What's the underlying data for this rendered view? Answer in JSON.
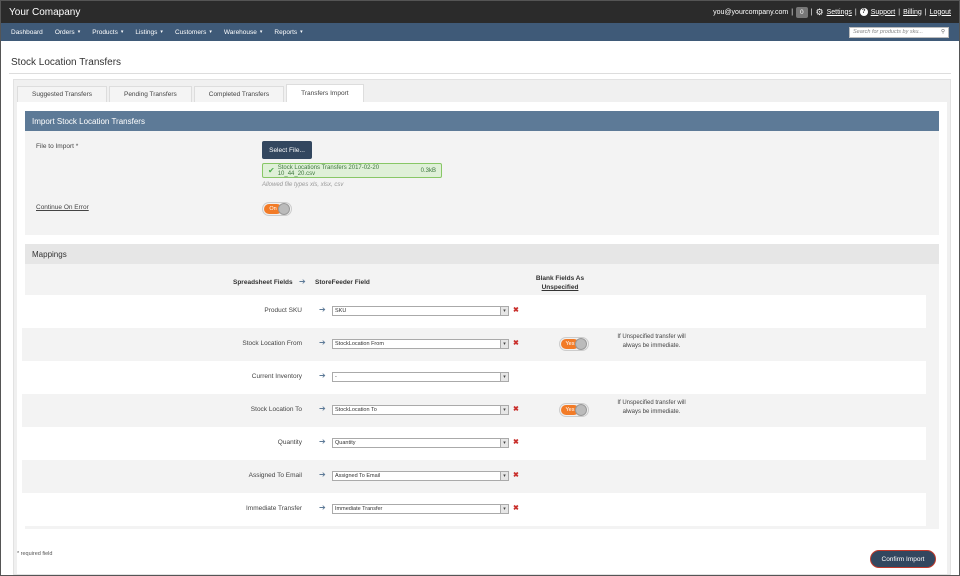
{
  "topbar": {
    "brand": "Your Comapany",
    "email": "you@yourcompany.com",
    "sep": "|",
    "count": "0",
    "settings": "Settings",
    "support": "Support",
    "billing": "Billing",
    "logout": "Logout"
  },
  "nav": {
    "items": [
      {
        "label": "Dashboard",
        "caret": ""
      },
      {
        "label": "Orders",
        "caret": "▾"
      },
      {
        "label": "Products",
        "caret": "▾"
      },
      {
        "label": "Listings",
        "caret": "▾"
      },
      {
        "label": "Customers",
        "caret": "▾"
      },
      {
        "label": "Warehouse",
        "caret": "▾"
      },
      {
        "label": "Reports",
        "caret": "▾"
      }
    ],
    "search_placeholder": "Search for products by sku..."
  },
  "page": {
    "title": "Stock Location Transfers"
  },
  "tabs": [
    {
      "label": "Suggested Transfers"
    },
    {
      "label": "Pending Transfers"
    },
    {
      "label": "Completed Transfers"
    },
    {
      "label": "Transfers Import"
    }
  ],
  "import": {
    "heading": "Import Stock Location Transfers",
    "file_label": "File to Import *",
    "select_button": "Select File...",
    "file_name": "Stock Locations Transfers 2017-02-20 10_44_20.csv",
    "file_size": "0.3kB",
    "allowed": "Allowed file types xls, xlsx, csv",
    "continue_label": "Continue On Error",
    "toggle_on": "On"
  },
  "mappings": {
    "heading": "Mappings",
    "col_spreadsheet": "Spreadsheet Fields",
    "col_storefeeder": "StoreFeeder Field",
    "col_blank_1": "Blank Fields As",
    "col_blank_2": "Unspecified",
    "toggle_yes": "Yes",
    "rows": [
      {
        "label": "Product SKU",
        "value": "SKU"
      },
      {
        "label": "Stock Location From",
        "value": "StockLocation From",
        "note": "If Unspecified transfer will always be immediate."
      },
      {
        "label": "Current Inventory",
        "value": "-"
      },
      {
        "label": "Stock Location To",
        "value": "StockLocation To",
        "note": "If Unspecified transfer will always be immediate."
      },
      {
        "label": "Quantity",
        "value": "Quantity"
      },
      {
        "label": "Assigned To Email",
        "value": "Assigned To Email"
      },
      {
        "label": "Immediate Transfer",
        "value": "Immediate Transfer"
      }
    ]
  },
  "footer": {
    "required": "* required field",
    "confirm": "Confirm Import"
  }
}
